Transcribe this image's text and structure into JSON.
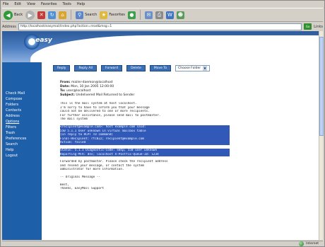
{
  "menubar": [
    "File",
    "Edit",
    "View",
    "Favorites",
    "Tools",
    "Help"
  ],
  "toolbar": {
    "back_label": "Back",
    "search_label": "Search",
    "favorites_label": "Favorites"
  },
  "address": {
    "label": "Address",
    "value": "http://localhost/easymail/index.php?action=read&msg=1",
    "go_label": "Go",
    "links_label": "Links"
  },
  "logo": {
    "text": "easy"
  },
  "sidebar": {
    "items": [
      "Check Mail",
      "Compose",
      "Folders",
      "Contacts",
      "Address",
      "Options",
      "Filters",
      "Trash",
      "Preferences",
      "Search",
      "Help",
      "Logout"
    ]
  },
  "nav_buttons": [
    "Reply",
    "Reply All",
    "Forward",
    "Delete",
    "Move To"
  ],
  "folder_select": {
    "value": "Choose Folder"
  },
  "message": {
    "from_label": "From:",
    "from_value": "mailer-daemon@localhost",
    "date_label": "Date:",
    "date_value": "Mon, 10 Jan 2005 12:00:00",
    "to_label": "To:",
    "to_value": "user@localhost",
    "subject_label": "Subject:",
    "subject_value": "Undelivered Mail Returned to Sender",
    "body_lines": [
      "This is the mail system at host localhost.",
      "I'm sorry to have to inform you that your message",
      "could not be delivered to one or more recipients.",
      "For further assistance, please send mail to postmaster.",
      "The mail system",
      "",
      "<recipient@example.com>: host example.com said:",
      "550 5.1.1 User unknown in virtual mailbox table",
      "(in reply to RCPT TO command)",
      "Final-Recipient: rfc822; recipient@example.com",
      "Action: failed",
      "",
      "Status: 5.1.1 Diagnostic-Code: smtp; 550 user unknown",
      "Reporting-MTA: dns; localhost X-Postfix-Queue-ID: 1234",
      "",
      "Forwarded by postmaster. Please check the recipient address",
      "and resend your message, or contact the system",
      "administrator for more information.",
      "",
      "-- Original Message --",
      "",
      "Best,",
      "Thanks, EasyMail Support"
    ],
    "highlight_start": 6,
    "highlight_end": 13
  },
  "status": {
    "zone": "Internet"
  }
}
